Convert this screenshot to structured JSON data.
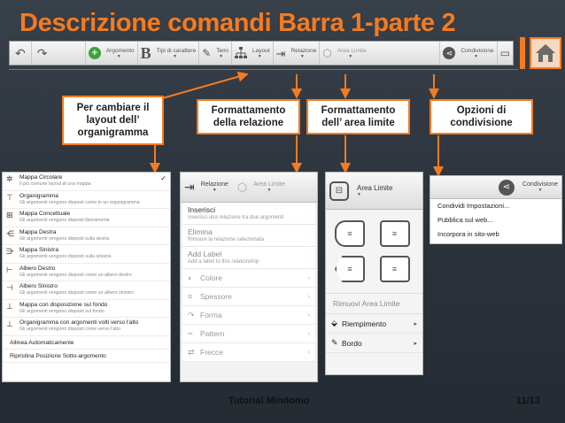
{
  "title": "Descrizione comandi Barra 1-parte 2",
  "toolbar": {
    "argomento": "Argomento",
    "tipi_carattere": "Tipi di carattere",
    "temi": "Temi",
    "layout": "Layout",
    "relazione": "Relazione",
    "area_limite": "Area Limite",
    "condivisione": "Condivisione"
  },
  "callouts": {
    "layout": "Per cambiare il layout dell’ organigramma",
    "relazione": "Formattamento della relazione",
    "area_limite": "Formattamento dell’ area limite",
    "condivisione": "Opzioni di condivisione"
  },
  "layout_menu": {
    "items": [
      {
        "title": "Mappa Circolare",
        "desc": "Il più comune layout di una mappa",
        "icon": "circular-map-icon",
        "checked": true
      },
      {
        "title": "Organigramma",
        "desc": "Gli argomenti vengono disposti come in un organigramma",
        "icon": "org-chart-icon"
      },
      {
        "title": "Mappa Concettuale",
        "desc": "Gli argomenti vengono disposti liberamente",
        "icon": "concept-map-icon"
      },
      {
        "title": "Mappa Destra",
        "desc": "Gli argomenti vengono disposti sulla destra",
        "icon": "right-map-icon"
      },
      {
        "title": "Mappa Sinistra",
        "desc": "Gli argomenti vengono disposti sulla sinistra",
        "icon": "left-map-icon"
      },
      {
        "title": "Albero Destro",
        "desc": "Gli argomenti vengono disposti come un albero destro",
        "icon": "right-tree-icon"
      },
      {
        "title": "Albero Sinistro",
        "desc": "Gli argomenti vengono disposti come un albero sinistro",
        "icon": "left-tree-icon"
      },
      {
        "title": "Mappa con disposizione sul fondo",
        "desc": "Gli argomenti vengono disposti sul fondo",
        "icon": "bottom-map-icon"
      },
      {
        "title": "Organigramma con argomenti volti verso l'alto",
        "desc": "Gli argomenti vengono disposti come verso l'alto",
        "icon": "upward-org-icon"
      }
    ],
    "align_auto": "Allinea Automaticamente",
    "reset_position": "Ripristina Posizione Sotto-argomento"
  },
  "relation_menu": {
    "top_relazione": "Relazione",
    "top_area": "Area Limite",
    "insert_title": "Inserisci",
    "insert_desc": "Inserisci una relazione tra due argomenti",
    "delete_title": "Elimina",
    "delete_desc": "Rimuovi la relazione selezionata",
    "label_title": "Add Label",
    "label_desc": "Add a label to this relationship",
    "sub": [
      "Colore",
      "Spessore",
      "Forma",
      "Pattern",
      "Frecce"
    ]
  },
  "area_menu": {
    "top": "Area Limite",
    "remove": "Rimuovi Area Limite",
    "fill": "Riempimento",
    "border": "Bordo"
  },
  "share_menu": {
    "top": "Condivisione",
    "items": [
      "Condividi Impostazioni...",
      "Pubblica sul web...",
      "Incorpora in sito-web"
    ]
  },
  "footer": {
    "left": "Tutorial Mindomo",
    "right": "11/13"
  },
  "colors": {
    "accent": "#f47b20",
    "background": "#2f363f"
  }
}
